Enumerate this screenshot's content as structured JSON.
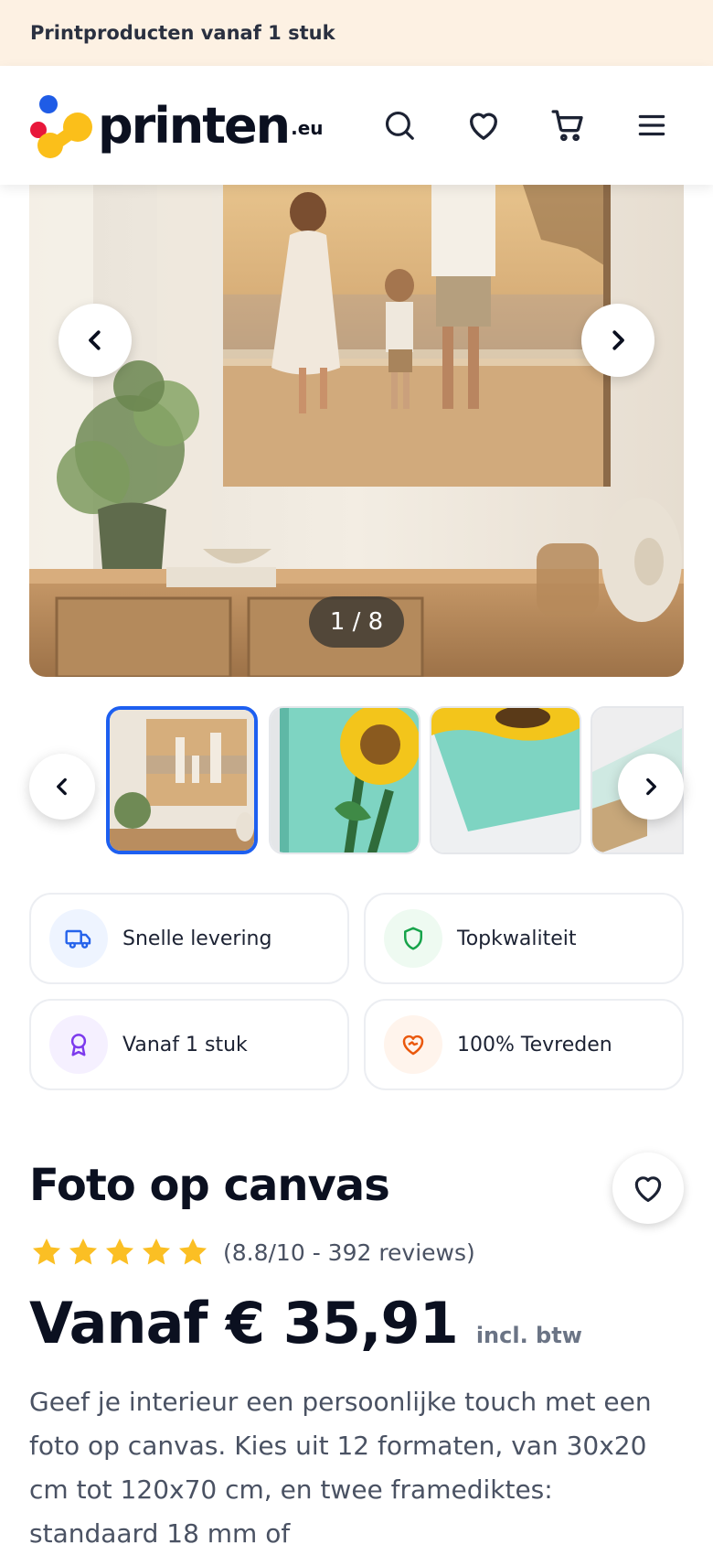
{
  "promo": {
    "text": "Printproducten vanaf 1 stuk"
  },
  "header": {
    "logo_word": "printen",
    "logo_tld": ".eu",
    "icons": [
      "search-icon",
      "heart-icon",
      "cart-icon",
      "menu-icon"
    ]
  },
  "gallery": {
    "counter": "1 / 8"
  },
  "features": [
    {
      "label": "Snelle levering",
      "icon": "truck-icon",
      "color": "#2563eb",
      "bg": "#eef4ff"
    },
    {
      "label": "Topkwaliteit",
      "icon": "shield-icon",
      "color": "#16a34a",
      "bg": "#eefaf1"
    },
    {
      "label": "Vanaf 1 stuk",
      "icon": "award-icon",
      "color": "#7c3aed",
      "bg": "#f5f0ff"
    },
    {
      "label": "100% Tevreden",
      "icon": "heart-handshake-icon",
      "color": "#ea580c",
      "bg": "#fff4ec"
    }
  ],
  "product": {
    "title": "Foto op canvas",
    "rating_text": "(8.8/10 - 392 reviews)",
    "stars": 5,
    "price": "Vanaf € 35,91",
    "vat_note": "incl. btw",
    "description": "Geef je interieur een persoonlijke touch met een foto op canvas. Kies uit 12 formaten, van 30x20 cm tot 120x70 cm, en twee framediktes: standaard 18 mm of"
  },
  "colors": {
    "accent": "#1d5ff0",
    "star": "#fbbf24",
    "promo_bg": "#fdf1e3"
  }
}
